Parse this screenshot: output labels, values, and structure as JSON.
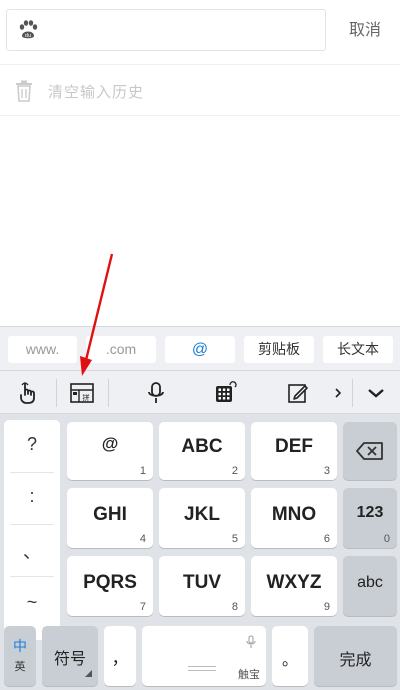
{
  "search": {
    "placeholder": "",
    "cancel_label": "取消"
  },
  "history": {
    "clear_label": "清空输入历史"
  },
  "keyboard": {
    "quick_keys": [
      "www.",
      ".com",
      "@",
      "剪贴板",
      "长文本"
    ],
    "tool_icons": [
      "gesture-hand-icon",
      "pinyin-layout-icon",
      "microphone-icon",
      "keypad-grid-icon",
      "edit-note-icon",
      "chevron-right-icon",
      "chevron-down-icon"
    ],
    "symbols": [
      "?",
      ":",
      "、",
      "~"
    ],
    "rows": [
      [
        {
          "label": "@",
          "num": "1"
        },
        {
          "label": "ABC",
          "num": "2"
        },
        {
          "label": "DEF",
          "num": "3"
        }
      ],
      [
        {
          "label": "GHI",
          "num": "4"
        },
        {
          "label": "JKL",
          "num": "5"
        },
        {
          "label": "MNO",
          "num": "6"
        }
      ],
      [
        {
          "label": "PQRS",
          "num": "7"
        },
        {
          "label": "TUV",
          "num": "8"
        },
        {
          "label": "WXYZ",
          "num": "9"
        }
      ]
    ],
    "side_keys": {
      "numeric_label": "123",
      "numeric_sub": "0",
      "abc_label": "abc"
    },
    "bottom": {
      "lang_cn": "中",
      "lang_en": "英",
      "symbols_label": "符号",
      "comma": "，",
      "space_brand": "触宝",
      "period": "。",
      "done_label": "完成"
    }
  },
  "colors": {
    "accent": "#1a7fd8",
    "annotation_arrow": "#e01010"
  }
}
